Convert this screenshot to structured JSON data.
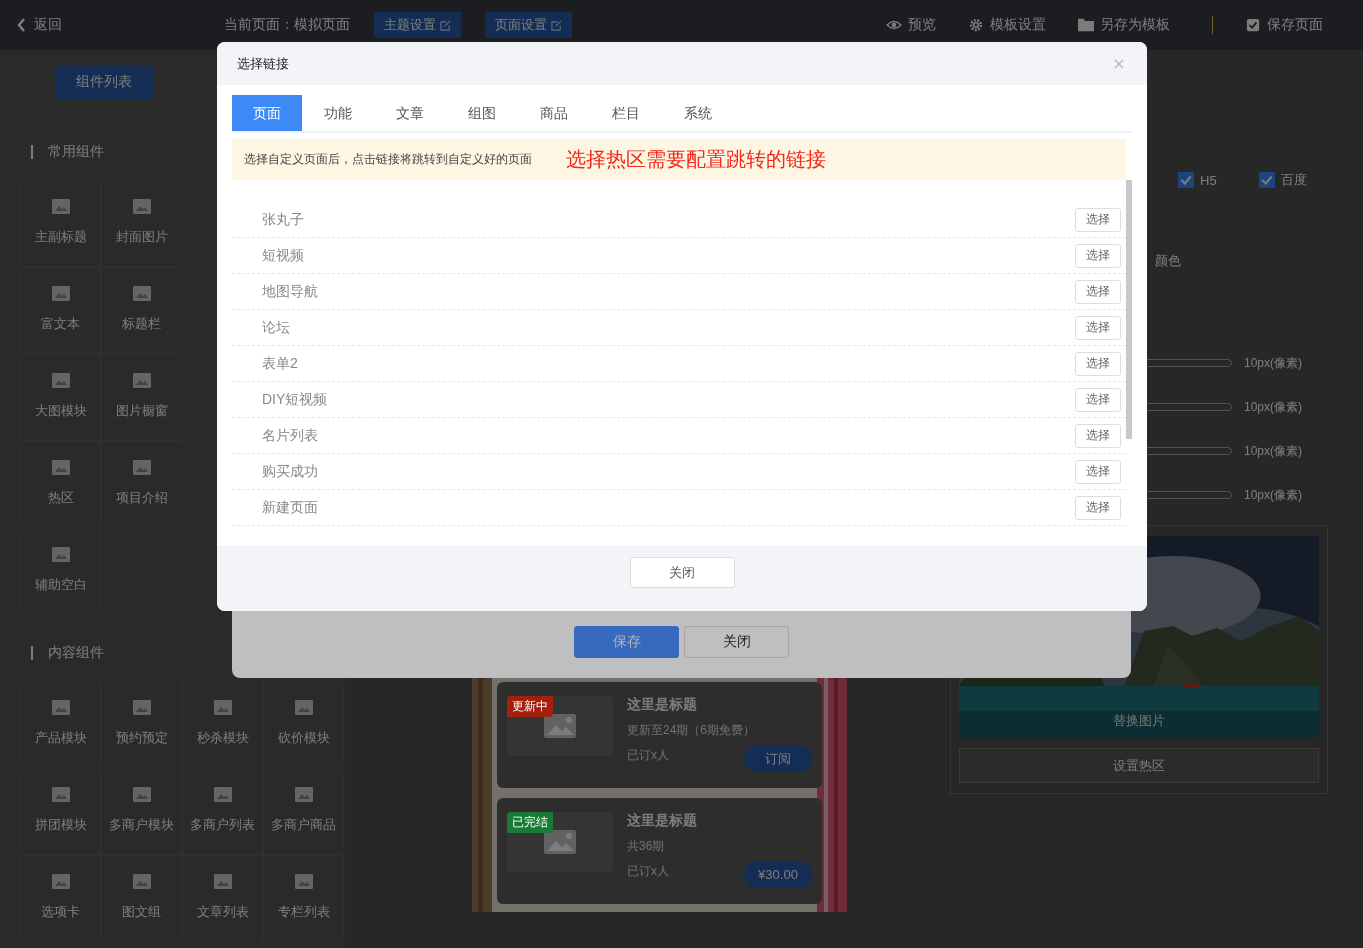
{
  "top_bar": {
    "back": "返回",
    "current_page": "当前页面：模拟页面",
    "buttons": [
      {
        "label": "主题设置"
      },
      {
        "label": "页面设置"
      }
    ],
    "actions": [
      {
        "label": "预览",
        "kind": "eye"
      },
      {
        "label": "模板设置",
        "kind": "gear"
      },
      {
        "label": "另存为模板",
        "kind": "folder"
      },
      {
        "label": "保存页面",
        "kind": "check"
      }
    ]
  },
  "left_panel": {
    "tab": "组件列表",
    "sections": [
      {
        "title": "常用组件",
        "rows": [
          [
            "主副标题",
            "封面图片"
          ],
          [
            "富文本",
            "标题栏"
          ],
          [
            "大图模块",
            "图片橱窗"
          ],
          [
            "热区",
            "项目介绍"
          ],
          [
            "辅助空白"
          ]
        ]
      },
      {
        "title": "内容组件",
        "rows": [
          [
            "产品模块",
            "预约预定",
            "秒杀模块",
            "砍价模块"
          ],
          [
            "拼团模块",
            "多商户模块",
            "多商户列表",
            "多商户商品"
          ],
          [
            "选项卡",
            "图文组",
            "文章列表",
            "专栏列表"
          ]
        ]
      }
    ]
  },
  "preview_cards": [
    {
      "badge": "更新中",
      "color": "#a3200f",
      "title": "这里是标题",
      "info": "更新至24期（6期免费）",
      "subscribers": "已订x人",
      "action": "订阅"
    },
    {
      "badge": "已完结",
      "color": "#187a35",
      "title": "这里是标题",
      "info": "共36期",
      "subscribers": "已订x人",
      "action": "¥30.00"
    }
  ],
  "right_panel": {
    "platforms": [
      {
        "label": "H5",
        "checked": true
      },
      {
        "label": "百度",
        "checked": true
      }
    ],
    "color_label": "颜色",
    "sliders": [
      {
        "reading": "10px(像素)"
      },
      {
        "reading": "10px(像素)"
      },
      {
        "reading": "10px(像素)"
      },
      {
        "reading": "10px(像素)"
      }
    ],
    "replace_label": "替换图片",
    "hotspot_button": "设置热区"
  },
  "hotspot_dialog": {
    "buttons": [
      {
        "label": "保存",
        "kind": "primary"
      },
      {
        "label": "关闭",
        "kind": "default"
      }
    ]
  },
  "link_dialog": {
    "title": "选择链接",
    "tabs": [
      {
        "label": "页面",
        "selected": true
      },
      {
        "label": "功能",
        "selected": false
      },
      {
        "label": "文章",
        "selected": false
      },
      {
        "label": "组图",
        "selected": false
      },
      {
        "label": "商品",
        "selected": false
      },
      {
        "label": "栏目",
        "selected": false
      },
      {
        "label": "系统",
        "selected": false
      }
    ],
    "notice": "选择自定义页面后，点击链接将跳转到自定义好的页面",
    "hint": "选择热区需要配置跳转的链接",
    "pages": [
      {
        "name": "张丸子",
        "action": "选择"
      },
      {
        "name": "短视频",
        "action": "选择"
      },
      {
        "name": "地图导航",
        "action": "选择"
      },
      {
        "name": "论坛",
        "action": "选择"
      },
      {
        "name": "表单2",
        "action": "选择"
      },
      {
        "name": "DIY短视频",
        "action": "选择"
      },
      {
        "name": "名片列表",
        "action": "选择"
      },
      {
        "name": "购买成功",
        "action": "选择"
      },
      {
        "name": "新建页面",
        "action": "选择"
      }
    ],
    "close": "关闭"
  }
}
